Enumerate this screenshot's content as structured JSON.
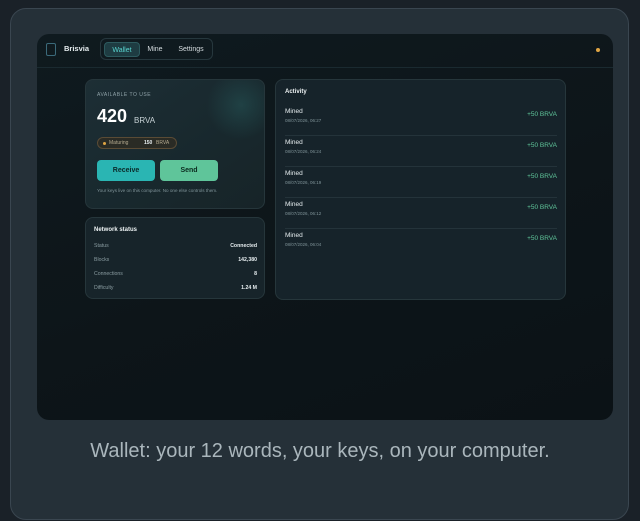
{
  "app": {
    "brand": "Brisvia",
    "tabs": [
      {
        "label": "Wallet",
        "active": true
      },
      {
        "label": "Mine",
        "active": false
      },
      {
        "label": "Settings",
        "active": false
      }
    ],
    "status_dot_color": "#e0a544"
  },
  "balance": {
    "label": "AVAILABLE TO USE",
    "amount": "420",
    "unit": "BRVA",
    "maturing_label": "Maturing",
    "maturing_amount": "150",
    "maturing_unit": "BRVA",
    "receive_label": "Receive",
    "send_label": "Send",
    "note": "Your keys live on this computer. No one else controls them."
  },
  "network": {
    "title": "Network status",
    "rows": [
      {
        "label": "Status",
        "value": "Connected"
      },
      {
        "label": "Blocks",
        "value": "142,380"
      },
      {
        "label": "Connections",
        "value": "8"
      },
      {
        "label": "Difficulty",
        "value": "1.24 M"
      }
    ]
  },
  "activity": {
    "title": "Activity",
    "items": [
      {
        "type": "Mined",
        "time": "08/07/2026, 06:27",
        "amount": "+50 BRVA"
      },
      {
        "type": "Mined",
        "time": "08/07/2026, 06:24",
        "amount": "+50 BRVA"
      },
      {
        "type": "Mined",
        "time": "08/07/2026, 06:19",
        "amount": "+50 BRVA"
      },
      {
        "type": "Mined",
        "time": "08/07/2026, 06:12",
        "amount": "+50 BRVA"
      },
      {
        "type": "Mined",
        "time": "08/07/2026, 06:04",
        "amount": "+50 BRVA"
      }
    ]
  },
  "caption": "Wallet: your 12 words, your keys, on your computer.",
  "colors": {
    "accent": "#2ab5b3",
    "send": "#5fc59a",
    "positive_amount": "#5fc59a"
  }
}
